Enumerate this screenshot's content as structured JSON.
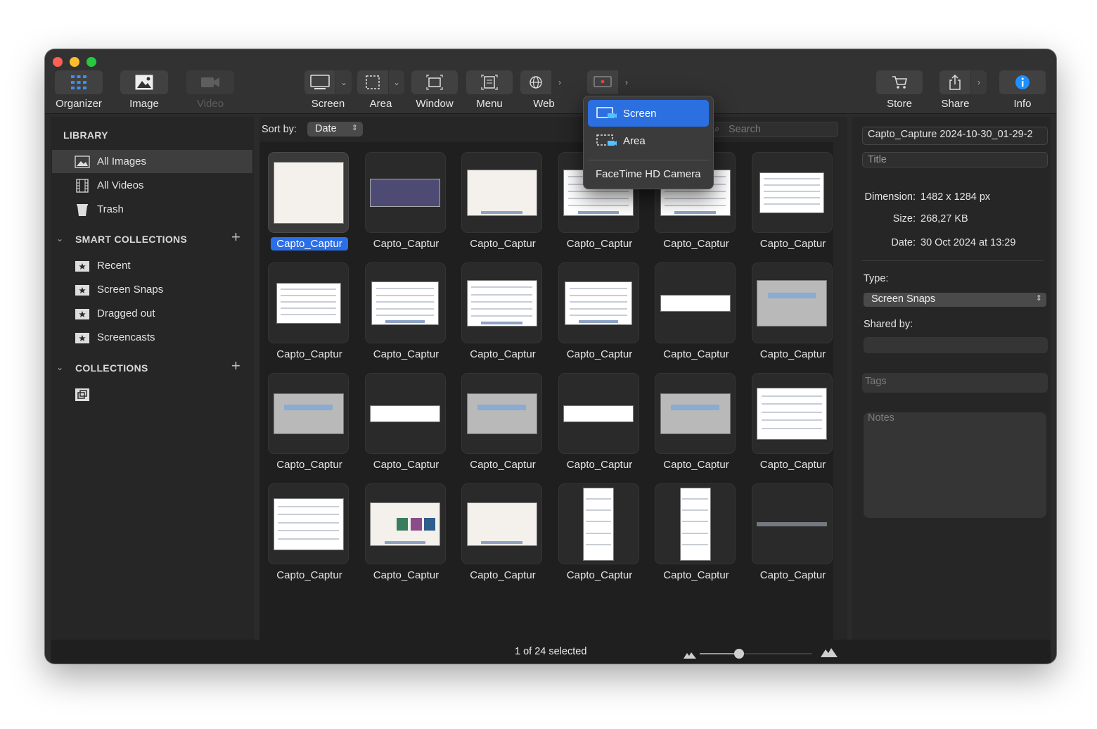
{
  "toolbar": {
    "organizer": "Organizer",
    "image": "Image",
    "video": "Video",
    "screen": "Screen",
    "area": "Area",
    "window": "Window",
    "menu": "Menu",
    "web": "Web",
    "store": "Store",
    "share": "Share",
    "info": "Info"
  },
  "capture_menu": {
    "items": [
      "Screen",
      "Area"
    ],
    "camera": "FaceTime HD Camera"
  },
  "sidebar": {
    "library_title": "LIBRARY",
    "library_items": [
      "All Images",
      "All Videos",
      "Trash"
    ],
    "smart_title": "SMART COLLECTIONS",
    "smart_items": [
      "Recent",
      "Screen Snaps",
      "Dragged out",
      "Screencasts"
    ],
    "collections_title": "COLLECTIONS"
  },
  "main": {
    "sort_label": "Sort by:",
    "sort_value": "Date",
    "search_placeholder": "Search",
    "item_label": "Capto_Captur",
    "item_count": 24,
    "selected_index": 0
  },
  "info_panel": {
    "filename": "Capto_Capture 2024-10-30_01-29-2",
    "title_placeholder": "Title",
    "dimension_label": "Dimension:",
    "dimension_value": "1482 x 1284 px",
    "size_label": "Size:",
    "size_value": "268,27 KB",
    "date_label": "Date:",
    "date_value": "30 Oct 2024 at 13:29",
    "type_label": "Type:",
    "type_value": "Screen Snaps",
    "shared_label": "Shared by:",
    "tags_placeholder": "Tags",
    "notes_placeholder": "Notes"
  },
  "status": {
    "selection_text": "1 of 24 selected",
    "zoom_fraction": 0.35
  },
  "colors": {
    "accent": "#2a6ee8",
    "info_icon": "#1e90ff"
  }
}
